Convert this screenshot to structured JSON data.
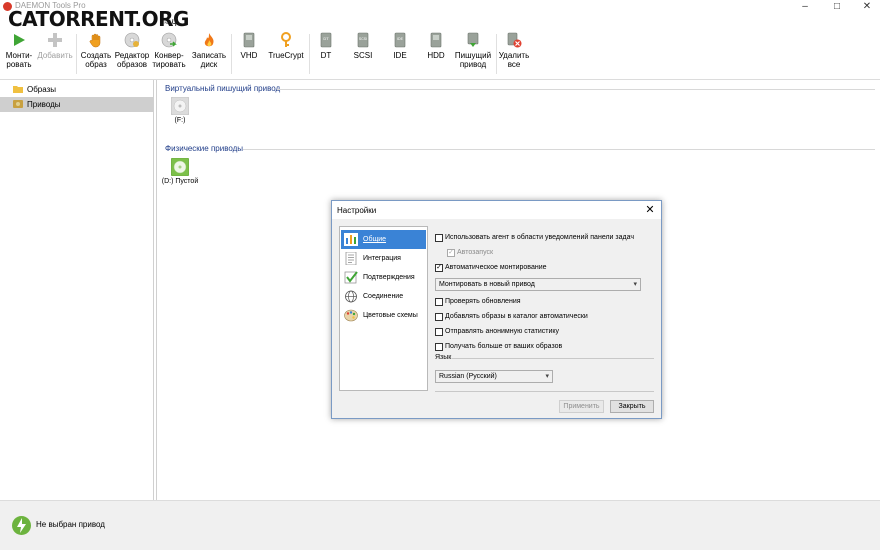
{
  "window": {
    "title": "DAEMON Tools Pro",
    "controls": [
      "minimize-icon",
      "maximize-icon",
      "close-icon"
    ]
  },
  "watermark": "CATORRENT.ORG",
  "menu": {
    "items": [
      "Вид"
    ]
  },
  "toolbar": {
    "buttons": [
      {
        "label": "Монти-\nровать",
        "icon": "play-icon",
        "enabled": true
      },
      {
        "label": "Добавить",
        "icon": "plus-icon",
        "enabled": false
      },
      {
        "label": "Создать\nобраз",
        "icon": "hand-icon",
        "enabled": true
      },
      {
        "label": "Редактор\nобразов",
        "icon": "disc-editor-icon",
        "enabled": true
      },
      {
        "label": "Конвер-\nтировать",
        "icon": "convert-icon",
        "enabled": true
      },
      {
        "label": "Записать\nдиск",
        "icon": "burn-icon",
        "enabled": true
      },
      {
        "label": "VHD",
        "icon": "vhd-icon",
        "enabled": true
      },
      {
        "label": "TrueCrypt",
        "icon": "key-icon",
        "enabled": true
      },
      {
        "label": "DT",
        "icon": "dt-drive-icon",
        "enabled": true
      },
      {
        "label": "SCSI",
        "icon": "scsi-drive-icon",
        "enabled": true
      },
      {
        "label": "IDE",
        "icon": "ide-drive-icon",
        "enabled": true
      },
      {
        "label": "HDD",
        "icon": "hdd-icon",
        "enabled": true
      },
      {
        "label": "Пишущий\nпривод",
        "icon": "writer-drive-icon",
        "enabled": true
      },
      {
        "label": "Удалить\nвсе",
        "icon": "remove-all-icon",
        "enabled": true
      }
    ]
  },
  "sidebar": {
    "items": [
      {
        "label": "Образы",
        "icon": "folder-icon",
        "active": false
      },
      {
        "label": "Приводы",
        "icon": "drive-icon",
        "active": true
      }
    ]
  },
  "content": {
    "virtual_group": {
      "label": "Виртуальный пишущий привод",
      "drive": "(F:)"
    },
    "physical_group": {
      "label": "Физические приводы",
      "drive": "(D:) Пустой"
    }
  },
  "status": {
    "text": "Не выбран привод"
  },
  "dialog": {
    "title": "Настройки",
    "nav": [
      {
        "label": "Общие",
        "icon": "general-settings-icon",
        "active": true
      },
      {
        "label": "Интеграция",
        "icon": "document-icon",
        "active": false
      },
      {
        "label": "Подтверждения",
        "icon": "checkmark-icon",
        "active": false
      },
      {
        "label": "Соединение",
        "icon": "globe-icon",
        "active": false
      },
      {
        "label": "Цветовые схемы",
        "icon": "palette-icon",
        "active": false
      }
    ],
    "options": {
      "agent": {
        "label": "Использовать агент в области уведомлений панели задач",
        "checked": false
      },
      "autostart": {
        "label": "Автозапуск",
        "checked": true,
        "disabled": true
      },
      "automount": {
        "label": "Автоматическое монтирование",
        "checked": true
      },
      "mount_mode": "Монтировать в новый привод",
      "updates": {
        "label": "Проверять обновления",
        "checked": false
      },
      "catalog": {
        "label": "Добавлять образы в каталог автоматически",
        "checked": false
      },
      "stats": {
        "label": "Отправлять анонимную статистику",
        "checked": false
      },
      "more_images": {
        "label": "Получать больше от ваших образов",
        "checked": false
      }
    },
    "language_label": "Язык",
    "language_value": "Russian (Русский)",
    "apply_label": "Применить",
    "close_label": "Закрыть"
  }
}
